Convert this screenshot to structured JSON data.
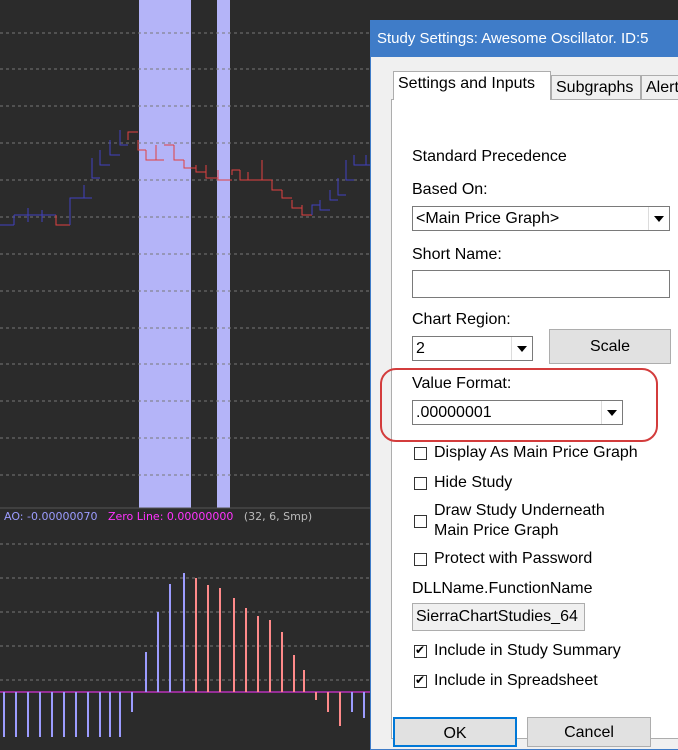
{
  "chart": {
    "ao_label": "AO: -0.00000070",
    "zero_label": "Zero Line: 0.00000000",
    "params_label": "(32, 6, Smp)",
    "colors": {
      "background": "#2b2b2b",
      "highlight": "#b4b4f8",
      "grid": "#777777",
      "ao_label": "#9c9cff",
      "zero_label": "#ff33ff",
      "params_label": "#bbbbbb",
      "bar_up": "#4040c0",
      "bar_down": "#e04040",
      "hist_up": "#9c9cff",
      "hist_down": "#ff8a8a",
      "zero_line": "#ff33ff"
    }
  },
  "dialog": {
    "title": "Study Settings: Awesome Oscillator. ID:5",
    "tabs": [
      "Settings and Inputs",
      "Subgraphs",
      "Alerts"
    ],
    "standard_precedence": "Standard Precedence",
    "based_on_label": "Based On:",
    "based_on_value": "<Main Price Graph>",
    "short_name_label": "Short Name:",
    "short_name_value": "",
    "chart_region_label": "Chart Region:",
    "chart_region_value": "2",
    "scale_button": "Scale",
    "value_format_label": "Value Format:",
    "value_format_value": ".00000001",
    "checkboxes": {
      "display_main": {
        "label": "Display As Main Price Graph",
        "checked": false
      },
      "hide_study": {
        "label": "Hide Study",
        "checked": false
      },
      "draw_underneath_1": "Draw Study Underneath",
      "draw_underneath_2": "Main Price Graph",
      "draw_underneath_checked": false,
      "protect": {
        "label": "Protect with Password",
        "checked": false
      },
      "include_summary": {
        "label": "Include in Study Summary",
        "checked": true
      },
      "include_spreadsheet": {
        "label": "Include in Spreadsheet",
        "checked": true
      }
    },
    "dll_label": "DLLName.FunctionName",
    "dll_value": "SierraChartStudies_64",
    "ok_button": "OK",
    "cancel_button": "Cancel"
  }
}
